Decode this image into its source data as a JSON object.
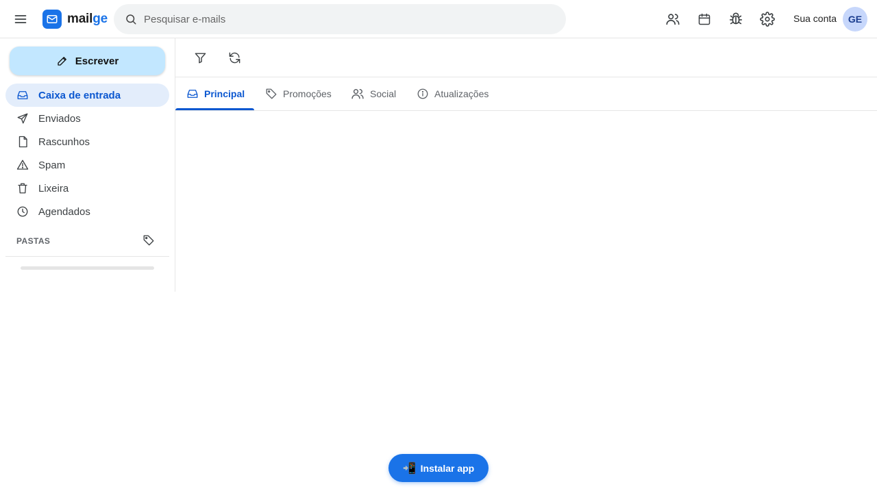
{
  "app": {
    "logo_part1": "mail",
    "logo_part2": "ge",
    "brand_color": "#1a73e8"
  },
  "header": {
    "search_placeholder": "Pesquisar e-mails",
    "icons": [
      "contacts-icon",
      "calendar-icon",
      "bug-icon",
      "settings-icon"
    ],
    "account_label": "Sua conta",
    "avatar_initials": "GE"
  },
  "sidebar": {
    "compose_label": "Escrever",
    "items": [
      {
        "label": "Caixa de entrada",
        "icon": "inbox-icon",
        "active": true
      },
      {
        "label": "Enviados",
        "icon": "send-icon"
      },
      {
        "label": "Rascunhos",
        "icon": "draft-icon"
      },
      {
        "label": "Spam",
        "icon": "warning-icon"
      },
      {
        "label": "Lixeira",
        "icon": "trash-icon"
      },
      {
        "label": "Agendados",
        "icon": "clock-icon"
      }
    ],
    "folders_label": "PASTAS"
  },
  "toolbar": {
    "icons": [
      "filter-icon",
      "refresh-icon"
    ]
  },
  "tabs": [
    {
      "label": "Principal",
      "icon": "inbox-icon",
      "active": true
    },
    {
      "label": "Promoções",
      "icon": "tag-icon"
    },
    {
      "label": "Social",
      "icon": "people-icon"
    },
    {
      "label": "Atualizações",
      "icon": "info-icon"
    }
  ],
  "install": {
    "emoji": "📲",
    "label": "Instalar app"
  }
}
